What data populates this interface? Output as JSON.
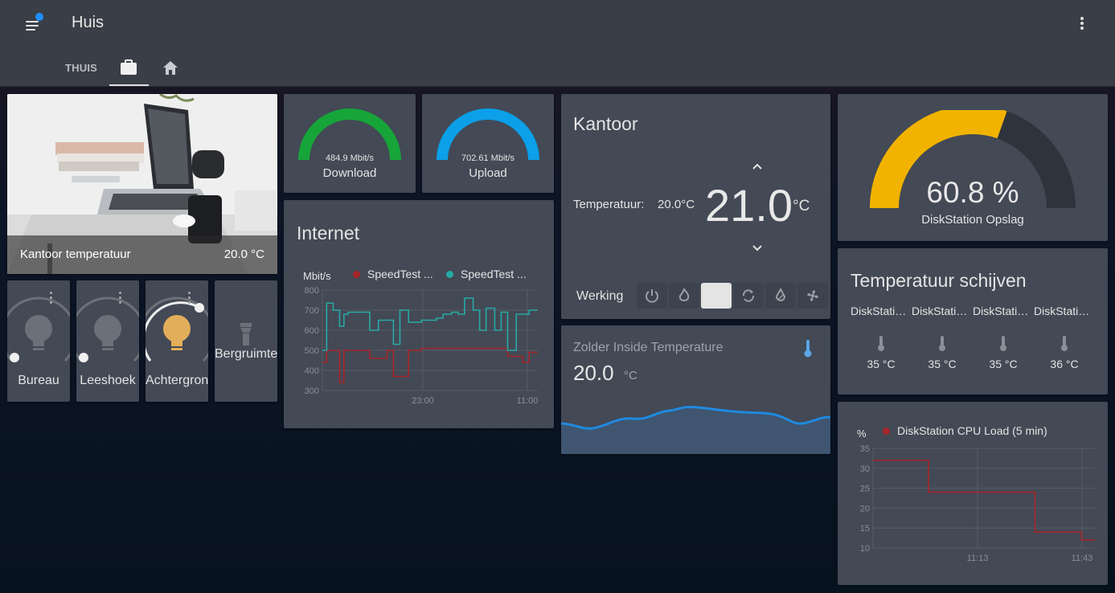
{
  "app": {
    "title": "Huis"
  },
  "tabs": {
    "thuis_label": "THUIS",
    "tab2_icon": "briefcase-icon",
    "tab3_icon": "home-icon"
  },
  "picture_card": {
    "name": "Kantoor temperatuur",
    "value": "20.0 °C"
  },
  "lights": [
    {
      "name": "Bureau",
      "state": "off",
      "brightness": 0
    },
    {
      "name": "Leeshoek",
      "state": "off",
      "brightness": 0
    },
    {
      "name": "Achtergrond",
      "state": "on",
      "brightness": 0.52
    }
  ],
  "scene": {
    "name": "Bergruimte",
    "icon": "flashlight-icon"
  },
  "download": {
    "value": "484.9 Mbit/s",
    "name": "Download",
    "fraction": 1.0,
    "color": "#17a53a"
  },
  "upload": {
    "value": "702.61 Mbit/s",
    "name": "Upload",
    "fraction": 1.0,
    "color": "#0ba0e9"
  },
  "internet": {
    "title": "Internet",
    "unit": "Mbit/s",
    "legend": [
      "SpeedTest ...",
      "SpeedTest ..."
    ],
    "colors": [
      "#a8262a",
      "#27a9a6"
    ]
  },
  "chart_data": [
    {
      "type": "line",
      "ylabel": "Mbit/s",
      "ylim": [
        300,
        800
      ],
      "yticks": [
        800,
        700,
        600,
        500,
        400,
        300
      ],
      "xticks": [
        "23:00",
        "11:00"
      ],
      "x": [
        0,
        0.02,
        0.05,
        0.08,
        0.1,
        0.12,
        0.15,
        0.18,
        0.22,
        0.26,
        0.3,
        0.33,
        0.36,
        0.4,
        0.43,
        0.46,
        0.5,
        0.53,
        0.56,
        0.6,
        0.63,
        0.66,
        0.7,
        0.73,
        0.76,
        0.8,
        0.83,
        0.86,
        0.9,
        0.93,
        0.96,
        1.0
      ],
      "series": [
        {
          "name": "SpeedTest ...",
          "color": "#a8262a",
          "values": [
            440,
            500,
            500,
            340,
            500,
            500,
            500,
            500,
            460,
            460,
            500,
            370,
            370,
            500,
            500,
            510,
            510,
            510,
            510,
            510,
            510,
            510,
            510,
            510,
            510,
            510,
            510,
            470,
            470,
            440,
            490,
            490
          ]
        },
        {
          "name": "SpeedTest ...",
          "color": "#27a9a6",
          "values": [
            500,
            735,
            700,
            620,
            680,
            690,
            690,
            690,
            600,
            650,
            650,
            530,
            700,
            640,
            640,
            650,
            650,
            660,
            680,
            690,
            680,
            760,
            700,
            600,
            710,
            600,
            690,
            500,
            680,
            680,
            700,
            700
          ]
        }
      ]
    },
    {
      "type": "line",
      "ylabel": "%",
      "ylim": [
        10,
        35
      ],
      "yticks": [
        35,
        30,
        25,
        20,
        15,
        10
      ],
      "xticks": [
        "11:13",
        "11:43"
      ],
      "x": [
        0,
        0.25,
        0.25,
        0.73,
        0.73,
        0.94,
        0.94,
        1.0
      ],
      "series": [
        {
          "name": "DiskStation CPU Load (5 min)",
          "color": "#a8262a",
          "values": [
            32,
            32,
            24,
            24,
            14,
            14,
            12,
            12
          ]
        }
      ]
    }
  ],
  "thermostat": {
    "title": "Kantoor",
    "current_label": "Temperatuur:",
    "current_value": "20.0°C",
    "target": "21.0",
    "unit": "°C",
    "mode_label": "Werking",
    "modes": [
      "power-icon",
      "flame-icon",
      "auto-icon",
      "cycle-icon",
      "dry-icon",
      "fan-icon"
    ],
    "active_mode_index": 2
  },
  "zolder": {
    "name": "Zolder Inside Temperature",
    "value": "20.0",
    "unit": "°C",
    "icon": "thermometer-icon"
  },
  "disk_gauge": {
    "value": "60.8 %",
    "name": "DiskStation Opslag",
    "fraction": 0.608,
    "color": "#f1b300"
  },
  "disks": {
    "title": "Temperatuur schijven",
    "items": [
      {
        "name": "DiskStation ...",
        "value": "35 °C"
      },
      {
        "name": "DiskStation ...",
        "value": "35 °C"
      },
      {
        "name": "DiskStation ...",
        "value": "35 °C"
      },
      {
        "name": "DiskStation ...",
        "value": "36 °C"
      }
    ]
  },
  "cpu": {
    "unit": "%",
    "legend": "DiskStation CPU Load (5 min)",
    "color": "#a8262a"
  }
}
